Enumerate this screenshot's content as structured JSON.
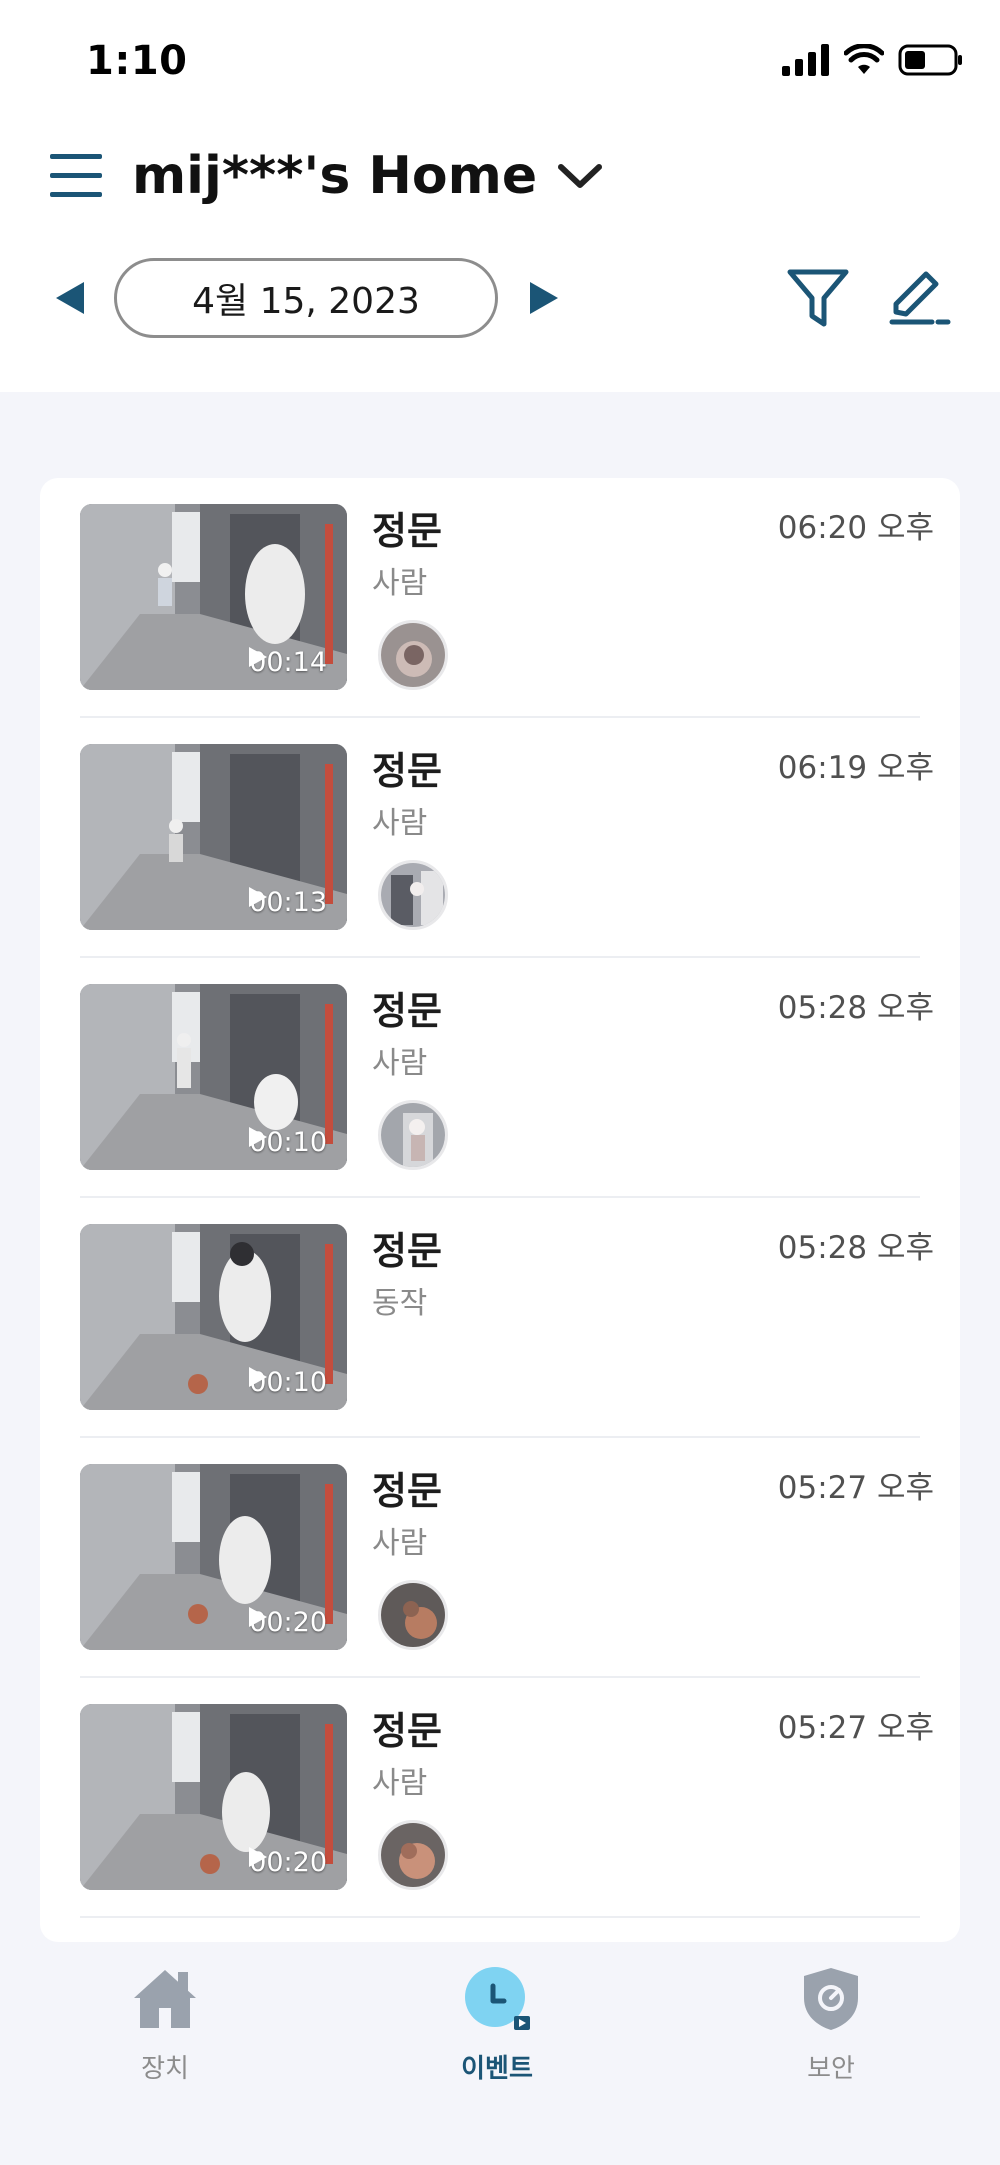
{
  "status_bar": {
    "time": "1:10"
  },
  "header": {
    "title": "mij***'s Home",
    "date": "4월 15, 2023"
  },
  "events": [
    {
      "title": "정문",
      "type": "사람",
      "time": "06:20 오후",
      "duration": "00:14",
      "has_avatar": true
    },
    {
      "title": "정문",
      "type": "사람",
      "time": "06:19 오후",
      "duration": "00:13",
      "has_avatar": true
    },
    {
      "title": "정문",
      "type": "사람",
      "time": "05:28 오후",
      "duration": "00:10",
      "has_avatar": true
    },
    {
      "title": "정문",
      "type": "동작",
      "time": "05:28 오후",
      "duration": "00:10",
      "has_avatar": false
    },
    {
      "title": "정문",
      "type": "사람",
      "time": "05:27 오후",
      "duration": "00:20",
      "has_avatar": true
    },
    {
      "title": "정문",
      "type": "사람",
      "time": "05:27 오후",
      "duration": "00:20",
      "has_avatar": true
    }
  ],
  "tabs": [
    {
      "label": "장치",
      "icon": "house-icon",
      "active": false
    },
    {
      "label": "이벤트",
      "icon": "clock-icon",
      "active": true
    },
    {
      "label": "보안",
      "icon": "shield-icon",
      "active": false
    }
  ],
  "colors": {
    "accent": "#1b5576",
    "active_tab_bg": "#7fd3f2",
    "background": "#f4f5fa"
  }
}
